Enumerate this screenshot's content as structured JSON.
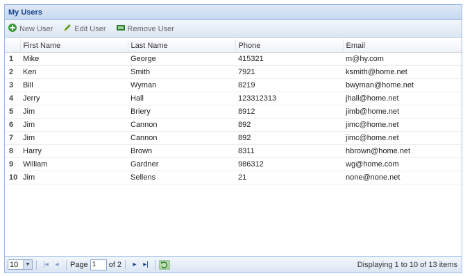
{
  "panel": {
    "title": "My Users"
  },
  "toolbar": {
    "new_label": "New User",
    "edit_label": "Edit User",
    "remove_label": "Remove User"
  },
  "columns": [
    "First Name",
    "Last Name",
    "Phone",
    "Email"
  ],
  "rows": [
    {
      "num": "1",
      "first": "Mike",
      "last": "George",
      "phone": "415321",
      "email": "m@hy.com"
    },
    {
      "num": "2",
      "first": "Ken",
      "last": "Smith",
      "phone": "7921",
      "email": "ksmith@home.net"
    },
    {
      "num": "3",
      "first": "Bill",
      "last": "Wyman",
      "phone": "8219",
      "email": "bwyman@home.net"
    },
    {
      "num": "4",
      "first": "Jerry",
      "last": "Hall",
      "phone": "123312313",
      "email": "jhall@home.net"
    },
    {
      "num": "5",
      "first": "Jim",
      "last": "Briery",
      "phone": "8912",
      "email": "jimb@home.net"
    },
    {
      "num": "6",
      "first": "Jim",
      "last": "Cannon",
      "phone": "892",
      "email": "jimc@home.net"
    },
    {
      "num": "7",
      "first": "Jim",
      "last": "Cannon",
      "phone": "892",
      "email": "jimc@home.net"
    },
    {
      "num": "8",
      "first": "Harry",
      "last": "Brown",
      "phone": "8311",
      "email": "hbrown@home.net"
    },
    {
      "num": "9",
      "first": "William",
      "last": "Gardner",
      "phone": "986312",
      "email": "wg@home.com"
    },
    {
      "num": "10",
      "first": "Jim",
      "last": "Sellens",
      "phone": "21",
      "email": "none@none.net"
    }
  ],
  "pager": {
    "page_size": "10",
    "page_label": "Page",
    "page_value": "1",
    "of_label": "of 2",
    "display_text": "Displaying 1 to 10 of 13 items"
  },
  "icons": {
    "add": "add-user-icon",
    "edit": "pencil-icon",
    "remove": "remove-user-icon",
    "first": "first-page-icon",
    "prev": "prev-page-icon",
    "next": "next-page-icon",
    "last": "last-page-icon",
    "refresh": "refresh-icon"
  },
  "colors": {
    "header_text": "#15428b",
    "border": "#99bbe8",
    "add_green": "#3a9b3a"
  }
}
